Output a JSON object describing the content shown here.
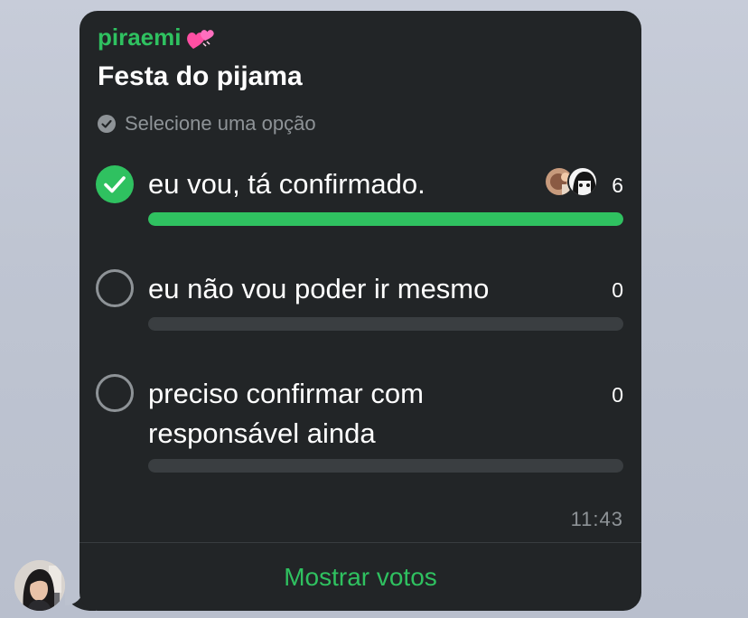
{
  "message": {
    "sender": "piraemi",
    "sender_emoji_icon": "two-hearts-icon",
    "title": "Festa do pijama",
    "hint": "Selecione uma opção",
    "options": [
      {
        "label": "eu vou, tá confirmado.",
        "count": "6",
        "selected": true,
        "fraction": 1.0
      },
      {
        "label": "eu não vou poder ir mesmo",
        "count": "0",
        "selected": false,
        "fraction": 0
      },
      {
        "label": "preciso confirmar com responsável ainda",
        "count": "0",
        "selected": false,
        "fraction": 0
      }
    ],
    "time": "11:43",
    "show_votes": "Mostrar votos"
  },
  "colors": {
    "accent": "#2fc160",
    "bubble": "#222527",
    "muted": "#8e9397",
    "track": "#3a3e41"
  }
}
